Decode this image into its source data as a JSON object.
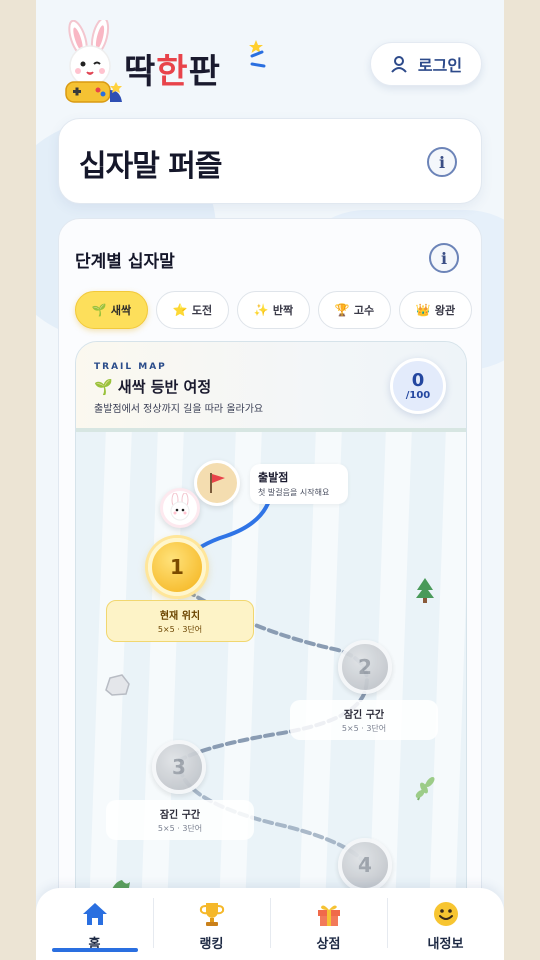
{
  "app": {
    "logo": {
      "part1": "딱",
      "part2": "한",
      "part3": "판"
    },
    "login_label": "로그인"
  },
  "page": {
    "title": "십자말 퍼즐"
  },
  "section": {
    "title": "단계별 십자말",
    "tabs": [
      {
        "label": "새싹",
        "icon": "sprout-icon",
        "active": true
      },
      {
        "label": "도전",
        "icon": "star-icon",
        "active": false
      },
      {
        "label": "반짝",
        "icon": "sparkle-icon",
        "active": false
      },
      {
        "label": "고수",
        "icon": "trophy-icon",
        "active": false
      },
      {
        "label": "왕관",
        "icon": "crown-icon",
        "active": false
      }
    ]
  },
  "trail": {
    "eyebrow": "TRAIL MAP",
    "title": "새싹 등반 여정",
    "subtitle": "출발점에서 정상까지 길을 따라 올라가요",
    "progress": {
      "current": "0",
      "total": "/100"
    },
    "start": {
      "title": "출발점",
      "subtitle": "첫 발걸음을 시작해요"
    },
    "stages": [
      {
        "number": "1",
        "title": "현재 위치",
        "detail": "5×5 · 3단어",
        "state": "current"
      },
      {
        "number": "2",
        "title": "잠긴 구간",
        "detail": "5×5 · 3단어",
        "state": "locked"
      },
      {
        "number": "3",
        "title": "잠긴 구간",
        "detail": "5×5 · 3단어",
        "state": "locked"
      },
      {
        "number": "4",
        "title": "",
        "detail": "",
        "state": "locked"
      }
    ]
  },
  "nav": {
    "items": [
      {
        "label": "홈",
        "icon": "home-icon",
        "active": true
      },
      {
        "label": "랭킹",
        "icon": "trophy-icon",
        "active": false
      },
      {
        "label": "상점",
        "icon": "gift-icon",
        "active": false
      },
      {
        "label": "내정보",
        "icon": "smiley-icon",
        "active": false
      }
    ]
  },
  "colors": {
    "accent": "#2a6fe0",
    "tab_active": "#fddf5b",
    "current_node": "#f4b21a",
    "path_active": "#2f74e6",
    "path_locked": "#8a9cb3"
  }
}
